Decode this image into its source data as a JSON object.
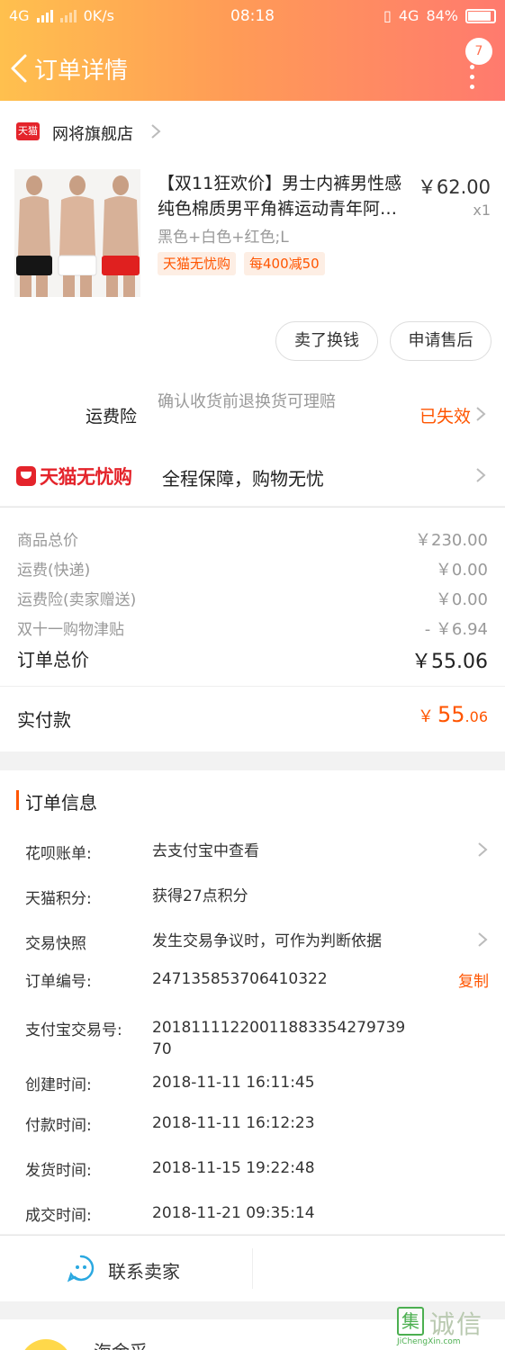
{
  "status_bar": {
    "network_left": "4G",
    "speed": "0K/s",
    "time": "08:18",
    "network_right": "4G",
    "battery": "84%",
    "battery_level": 0.84
  },
  "nav": {
    "title": "订单详情",
    "badge_count": "7"
  },
  "shop": {
    "badge": "天猫",
    "name": "网将旗舰店"
  },
  "product": {
    "title": "【双11狂欢价】男士内裤男性感纯色棉质男平角裤运动青年阿…",
    "price": "￥62.00",
    "qty": "x1",
    "sku": "黑色+白色+红色;L",
    "tags": [
      "天猫无忧购",
      "每400减50"
    ],
    "underwear_colors": [
      "#151515",
      "#ffffff",
      "#e0201f"
    ]
  },
  "actions": {
    "sell": "卖了换钱",
    "after_sale": "申请售后"
  },
  "insurance": {
    "label": "运费险",
    "desc": "确认收货前退换货可理赔",
    "status": "已失效"
  },
  "tmall_worry_free": {
    "logo": "天猫无忧购",
    "slogan": "全程保障，购物无忧"
  },
  "price_summary": {
    "rows": [
      {
        "label": "商品总价",
        "value": "￥230.00"
      },
      {
        "label": "运费(快递)",
        "value": "￥0.00"
      },
      {
        "label": "运费险(卖家赠送)",
        "value": "￥0.00"
      },
      {
        "label": "双十一购物津贴",
        "value": "- ￥6.94"
      }
    ],
    "total_label": "订单总价",
    "total_value": "￥55.06",
    "paid_label": "实付款",
    "paid_currency": "￥",
    "paid_int": "55",
    "paid_dec": ".06"
  },
  "order_info": {
    "title": "订单信息",
    "rows": [
      {
        "key": "花呗账单:",
        "value": "去支付宝中查看"
      },
      {
        "key": "天猫积分:",
        "value": "获得27点积分"
      },
      {
        "key": "交易快照",
        "value": "发生交易争议时，可作为判断依据"
      },
      {
        "key": "订单编号:",
        "value": "247135853706410322"
      },
      {
        "key": "支付宝交易号:",
        "value": "2018111122001188335427973970"
      },
      {
        "key": "创建时间:",
        "value": "2018-11-11 16:11:45"
      },
      {
        "key": "付款时间:",
        "value": "2018-11-11 16:12:23"
      },
      {
        "key": "发货时间:",
        "value": "2018-11-15 19:22:48"
      },
      {
        "key": "成交时间:",
        "value": "2018-11-21 09:35:14"
      }
    ],
    "copy_label": "复制"
  },
  "contact": {
    "label": "联系卖家"
  },
  "peek": {
    "text": "海金采"
  },
  "watermark": {
    "box": "集",
    "text": "诚信",
    "url": "JiChengXin.com"
  }
}
